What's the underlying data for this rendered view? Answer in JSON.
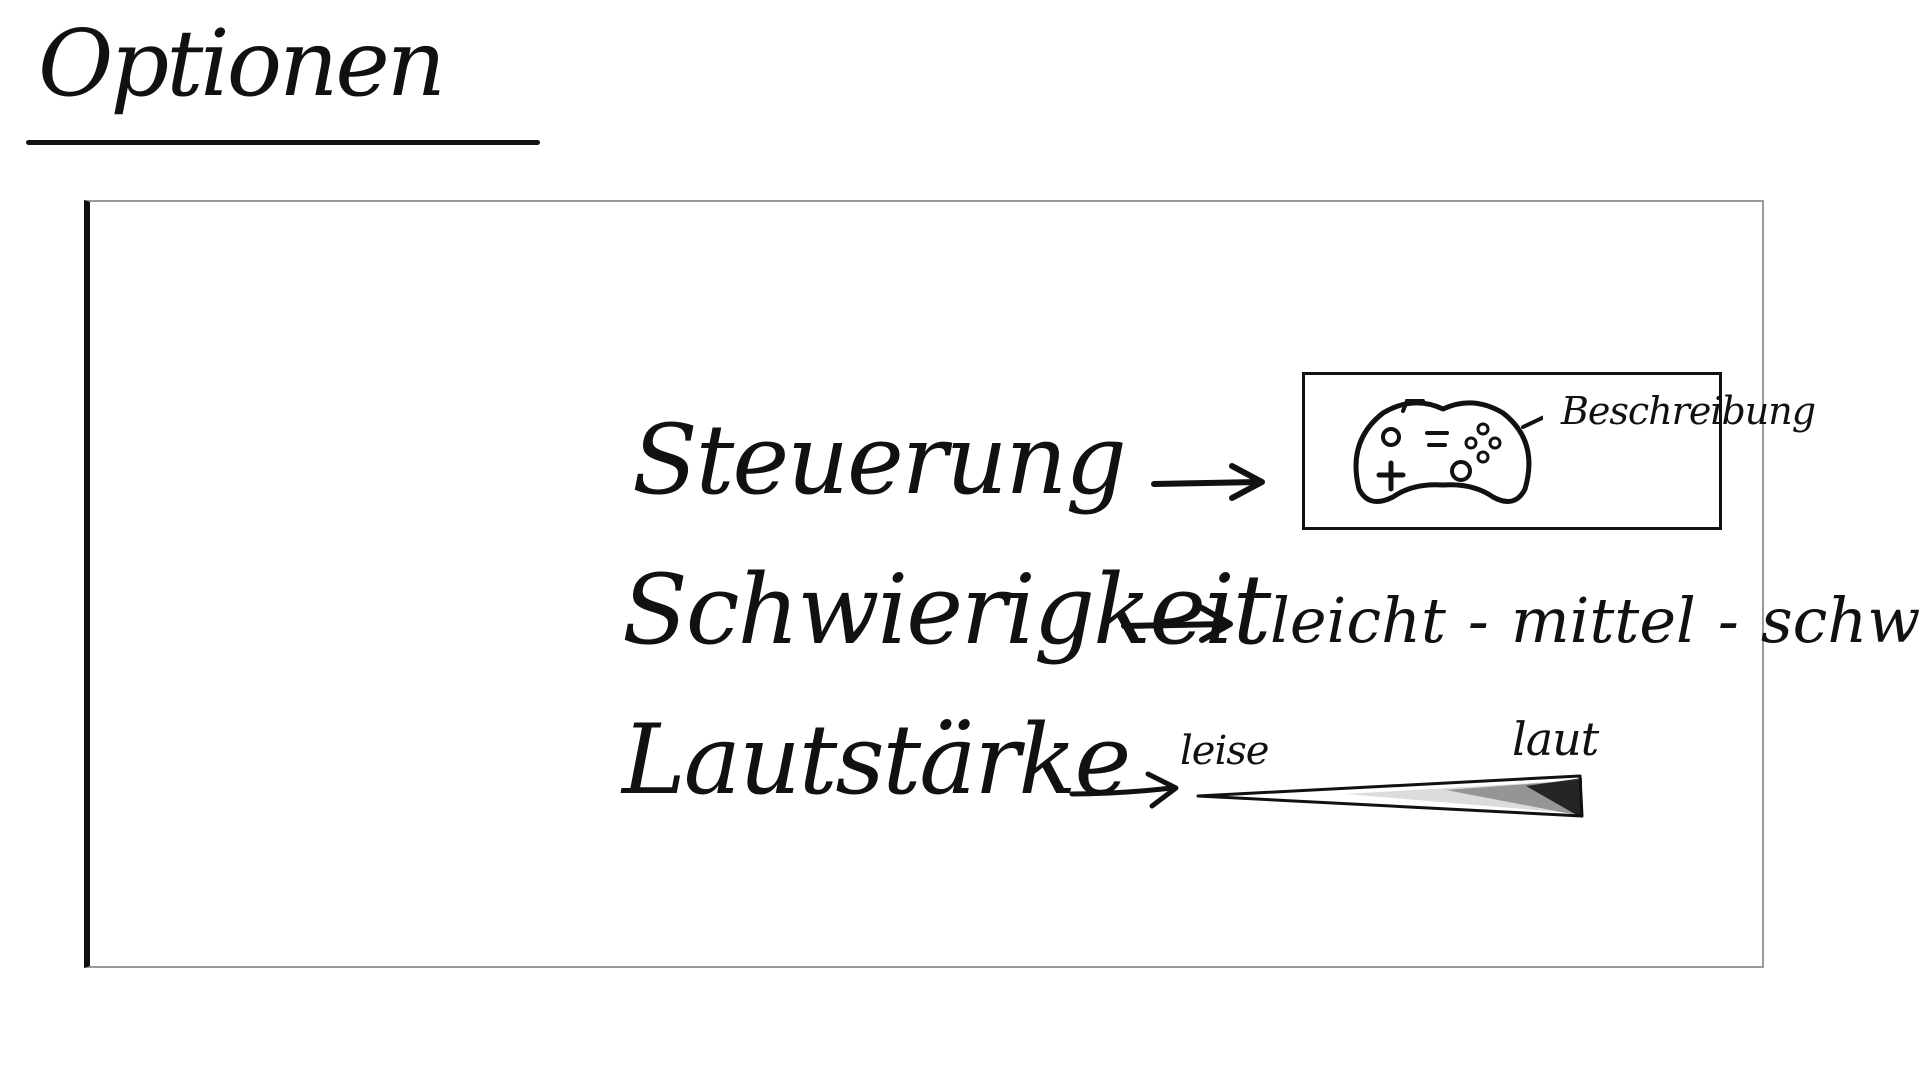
{
  "header": {
    "title": "Optionen"
  },
  "options": {
    "controls": {
      "label": "Steuerung",
      "description_label": "Beschreibung",
      "icon": "gamepad-icon"
    },
    "difficulty": {
      "label": "Schwierigkeit",
      "choices": [
        "leicht",
        "mittel",
        "schwer"
      ],
      "separator": "-"
    },
    "volume": {
      "label": "Lautstärke",
      "low_label": "leise",
      "high_label": "laut"
    }
  },
  "icons": {
    "arrow": "arrow-right-icon",
    "gamepad": "gamepad-icon"
  },
  "colors": {
    "ink": "#111111",
    "frame": "#9a9a9a",
    "background": "#ffffff"
  }
}
